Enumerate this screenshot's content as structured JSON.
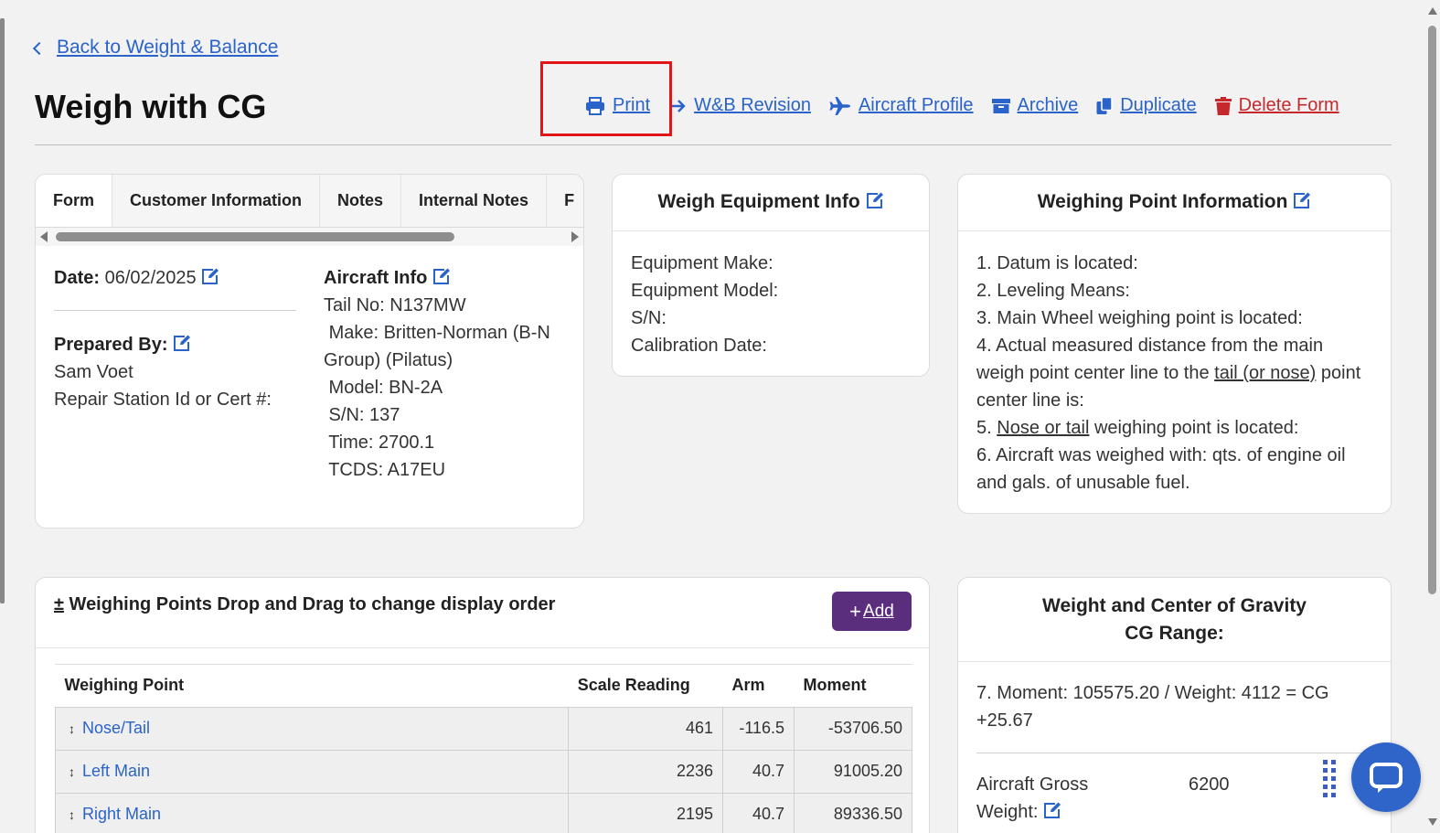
{
  "nav": {
    "back_label": "Back to Weight & Balance"
  },
  "page_title": "Weigh with CG",
  "actions": {
    "print": "Print",
    "revision": "W&B Revision",
    "profile": "Aircraft Profile",
    "archive": "Archive",
    "duplicate": "Duplicate",
    "delete": "Delete Form"
  },
  "tabs": [
    "Form",
    "Customer Information",
    "Notes",
    "Internal Notes",
    "F"
  ],
  "form": {
    "date_label": "Date:",
    "date_value": "06/02/2025",
    "prepared_label": "Prepared By:",
    "prepared_name": "Sam Voet",
    "repair_station": "Repair Station Id or Cert #:",
    "aircraft_info_label": "Aircraft Info",
    "tail": "Tail No: N137MW",
    "make": " Make: Britten-Norman (B-N Group) (Pilatus)",
    "model": " Model: BN-2A",
    "sn": " S/N: 137",
    "time": " Time: 2700.1",
    "tcds": " TCDS: A17EU"
  },
  "equipment": {
    "title": "Weigh Equipment Info",
    "make": "Equipment Make:",
    "model": "Equipment Model:",
    "sn": "S/N:",
    "calibration": "Calibration Date:"
  },
  "weighing_info": {
    "title": "Weighing Point Information",
    "l1": "1. Datum is located:",
    "l2": "2. Leveling Means:",
    "l3": "3. Main Wheel weighing point is located:",
    "l4a": "4. Actual measured distance from the main weigh point center line to the ",
    "l4u": "tail (or nose)",
    "l4b": " point center line is:",
    "l5a": "5. ",
    "l5u": "Nose or tail",
    "l5b": " weighing point is located:",
    "l6": "6. Aircraft was weighed with: qts. of engine oil and gals. of unusable fuel."
  },
  "points": {
    "title_prefix": "±",
    "title": "Weighing Points Drop and Drag to change display order",
    "add": "Add",
    "headers": [
      "Weighing Point",
      "Scale Reading",
      "Arm",
      "Moment"
    ],
    "rows": [
      {
        "name": "Nose/Tail",
        "scale": "461",
        "arm": "-116.5",
        "moment": "-53706.50"
      },
      {
        "name": "Left Main",
        "scale": "2236",
        "arm": "40.7",
        "moment": "91005.20"
      },
      {
        "name": "Right Main",
        "scale": "2195",
        "arm": "40.7",
        "moment": "89336.50"
      }
    ]
  },
  "cg": {
    "title_l1": "Weight and Center of Gravity",
    "title_l2": "CG Range:",
    "calc": "7. Moment: 105575.20 / Weight: 4112 = CG +25.67",
    "gross_label": "Aircraft Gross Weight:",
    "gross_value": "6200"
  },
  "colors": {
    "link": "#2a63c9",
    "danger": "#c6282d",
    "add_button": "#5b2e7d",
    "highlight": "#e0161b"
  }
}
